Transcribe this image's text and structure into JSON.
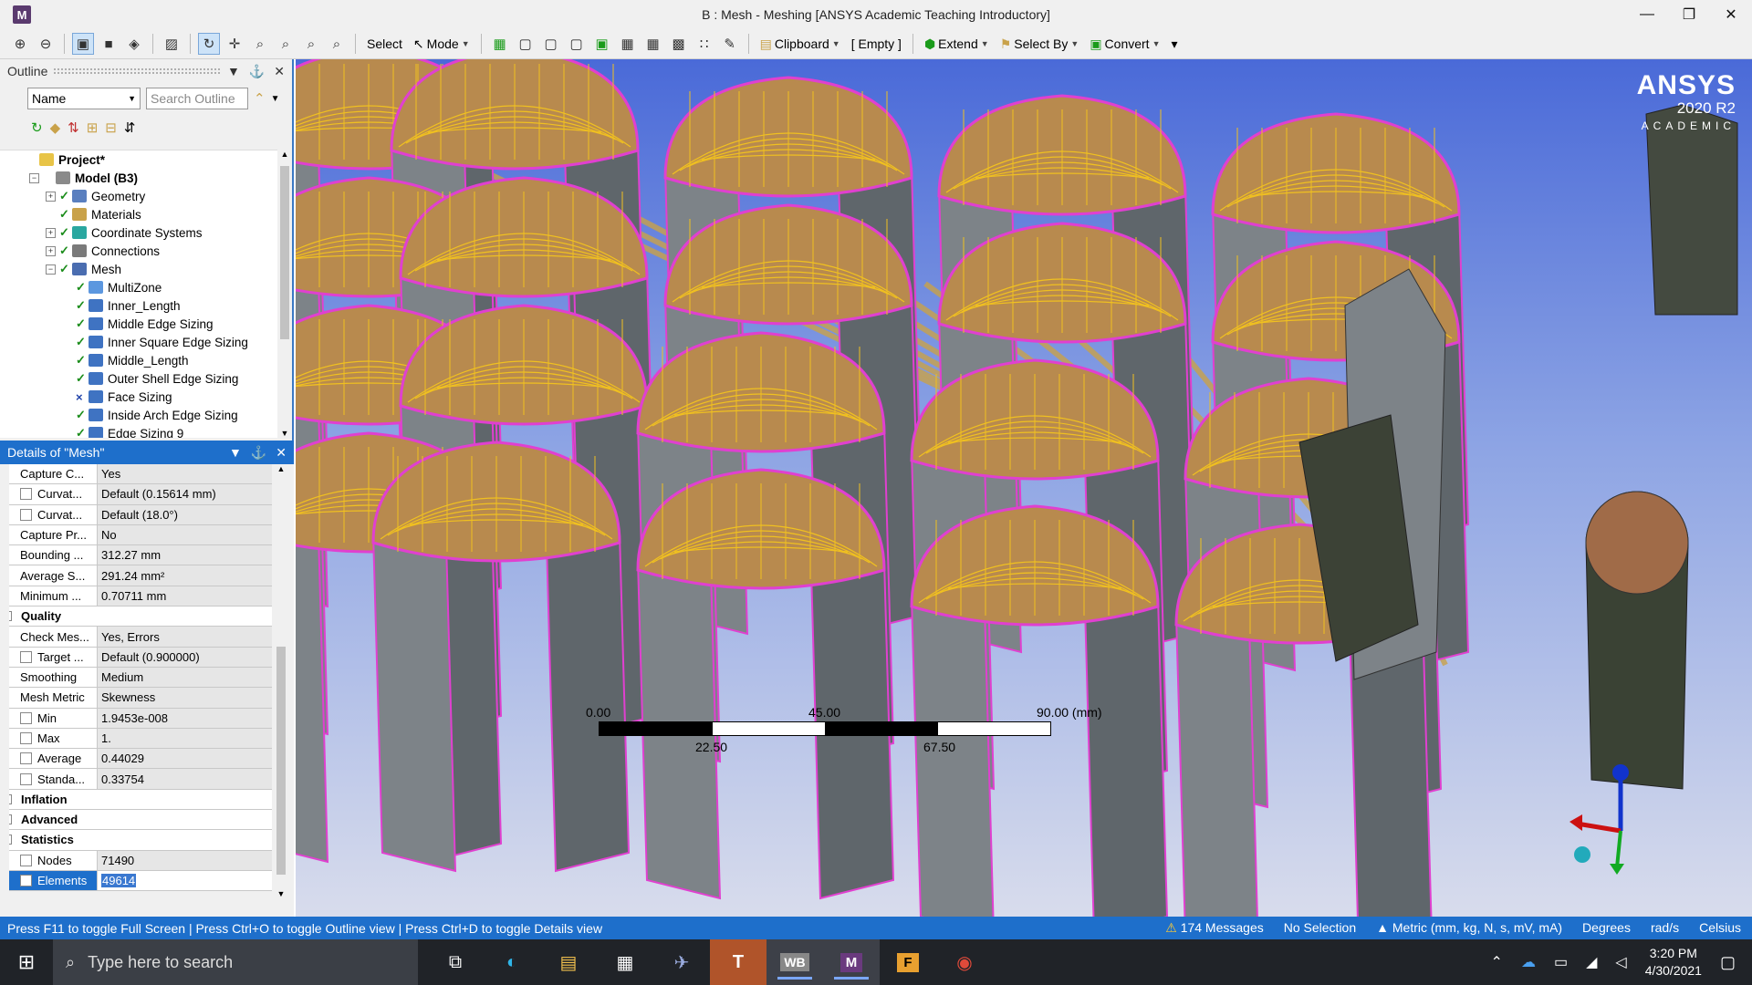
{
  "window": {
    "title": "B : Mesh - Meshing [ANSYS Academic Teaching Introductory]",
    "app_icon": "M",
    "controls": {
      "minimize": "—",
      "restore": "❐",
      "close": "✕"
    }
  },
  "toolbar": {
    "select_label": "Select",
    "mode_label": "Mode",
    "clipboard_label": "Clipboard",
    "empty_label": "[ Empty ]",
    "extend_label": "Extend",
    "select_by_label": "Select By",
    "convert_label": "Convert"
  },
  "outline": {
    "title": "Outline",
    "filter_select": "Name",
    "search_placeholder": "Search Outline",
    "tree": [
      {
        "label": "Project*",
        "level": 0,
        "expander": "",
        "check": "",
        "icon": "proj",
        "bold": true
      },
      {
        "label": "Model (B3)",
        "level": 1,
        "expander": "−",
        "check": "",
        "icon": "model",
        "bold": true
      },
      {
        "label": "Geometry",
        "level": 2,
        "expander": "+",
        "check": "✓",
        "icon": "geo"
      },
      {
        "label": "Materials",
        "level": 2,
        "expander": "",
        "check": "✓",
        "icon": "mat"
      },
      {
        "label": "Coordinate Systems",
        "level": 2,
        "expander": "+",
        "check": "✓",
        "icon": "cs"
      },
      {
        "label": "Connections",
        "level": 2,
        "expander": "+",
        "check": "✓",
        "icon": "con"
      },
      {
        "label": "Mesh",
        "level": 2,
        "expander": "−",
        "check": "✓",
        "icon": "mesh"
      },
      {
        "label": "MultiZone",
        "level": 3,
        "expander": "",
        "check": "✓",
        "icon": "mz"
      },
      {
        "label": "Inner_Length",
        "level": 3,
        "expander": "",
        "check": "✓",
        "icon": "sz"
      },
      {
        "label": "Middle Edge Sizing",
        "level": 3,
        "expander": "",
        "check": "✓",
        "icon": "sz"
      },
      {
        "label": "Inner Square Edge Sizing",
        "level": 3,
        "expander": "",
        "check": "✓",
        "icon": "sz"
      },
      {
        "label": "Middle_Length",
        "level": 3,
        "expander": "",
        "check": "✓",
        "icon": "sz"
      },
      {
        "label": "Outer Shell Edge Sizing",
        "level": 3,
        "expander": "",
        "check": "✓",
        "icon": "sz"
      },
      {
        "label": "Face Sizing",
        "level": 3,
        "expander": "",
        "check": "×",
        "icon": "sz"
      },
      {
        "label": "Inside Arch Edge Sizing",
        "level": 3,
        "expander": "",
        "check": "✓",
        "icon": "sz"
      },
      {
        "label": "Edge Sizing 9",
        "level": 3,
        "expander": "",
        "check": "✓",
        "icon": "sz"
      }
    ]
  },
  "details": {
    "title": "Details of \"Mesh\"",
    "rows": [
      {
        "type": "prop",
        "key": "Capture C...",
        "value": "Yes",
        "cb": false
      },
      {
        "type": "prop",
        "key": "Curvat...",
        "value": "Default (0.15614 mm)",
        "cb": true
      },
      {
        "type": "prop",
        "key": "Curvat...",
        "value": "Default (18.0°)",
        "cb": true
      },
      {
        "type": "prop",
        "key": "Capture Pr...",
        "value": "No",
        "cb": false
      },
      {
        "type": "prop",
        "key": "Bounding ...",
        "value": "312.27 mm",
        "cb": false
      },
      {
        "type": "prop",
        "key": "Average S...",
        "value": "291.24 mm²",
        "cb": false
      },
      {
        "type": "prop",
        "key": "Minimum ...",
        "value": "0.70711 mm",
        "cb": false
      },
      {
        "type": "group",
        "key": "Quality",
        "expander": "−"
      },
      {
        "type": "prop",
        "key": "Check Mes...",
        "value": "Yes, Errors",
        "cb": false
      },
      {
        "type": "prop",
        "key": "Target ...",
        "value": "Default (0.900000)",
        "cb": true
      },
      {
        "type": "prop",
        "key": "Smoothing",
        "value": "Medium",
        "cb": false
      },
      {
        "type": "prop",
        "key": "Mesh Metric",
        "value": "Skewness",
        "cb": false
      },
      {
        "type": "prop",
        "key": "Min",
        "value": "1.9453e-008",
        "cb": true
      },
      {
        "type": "prop",
        "key": "Max",
        "value": "1.",
        "cb": true
      },
      {
        "type": "prop",
        "key": "Average",
        "value": "0.44029",
        "cb": true
      },
      {
        "type": "prop",
        "key": "Standa...",
        "value": "0.33754",
        "cb": true
      },
      {
        "type": "group",
        "key": "Inflation",
        "expander": "+"
      },
      {
        "type": "group",
        "key": "Advanced",
        "expander": "+"
      },
      {
        "type": "group",
        "key": "Statistics",
        "expander": "−"
      },
      {
        "type": "prop",
        "key": "Nodes",
        "value": "71490",
        "cb": true
      },
      {
        "type": "prop",
        "key": "Elements",
        "value": "49614",
        "cb": true,
        "selected": true
      }
    ]
  },
  "viewport": {
    "logo_name": "ANSYS",
    "logo_version": "2020 R2",
    "logo_edition": "ACADEMIC",
    "scale": {
      "top_labels": [
        "0.00",
        "45.00",
        "90.00 (mm)"
      ],
      "bottom_labels": [
        "22.50",
        "67.50"
      ]
    },
    "colors": {
      "mesh_face": "#b88a4e",
      "mesh_edge": "#f0c020",
      "edge_outline": "#e040d0",
      "side": "#7d8388"
    }
  },
  "statusbar": {
    "hint": "Press F11 to toggle Full Screen | Press Ctrl+O to toggle Outline view | Press Ctrl+D to toggle Details view",
    "messages": "174 Messages",
    "selection": "No Selection",
    "units": "Metric (mm, kg, N, s, mV, mA)",
    "angle": "Degrees",
    "rotation": "rad/s",
    "temperature": "Celsius"
  },
  "taskbar": {
    "search_placeholder": "Type here to search",
    "apps": [
      "task-view",
      "edge",
      "file-explorer",
      "store",
      "spaceclaim",
      "teams",
      "workbench",
      "meshing",
      "fluent",
      "chrome"
    ],
    "app_labels": {
      "workbench": "WB",
      "meshing": "M",
      "fluent": "F",
      "teams": "T"
    },
    "time": "3:20 PM",
    "date": "4/30/2021"
  }
}
